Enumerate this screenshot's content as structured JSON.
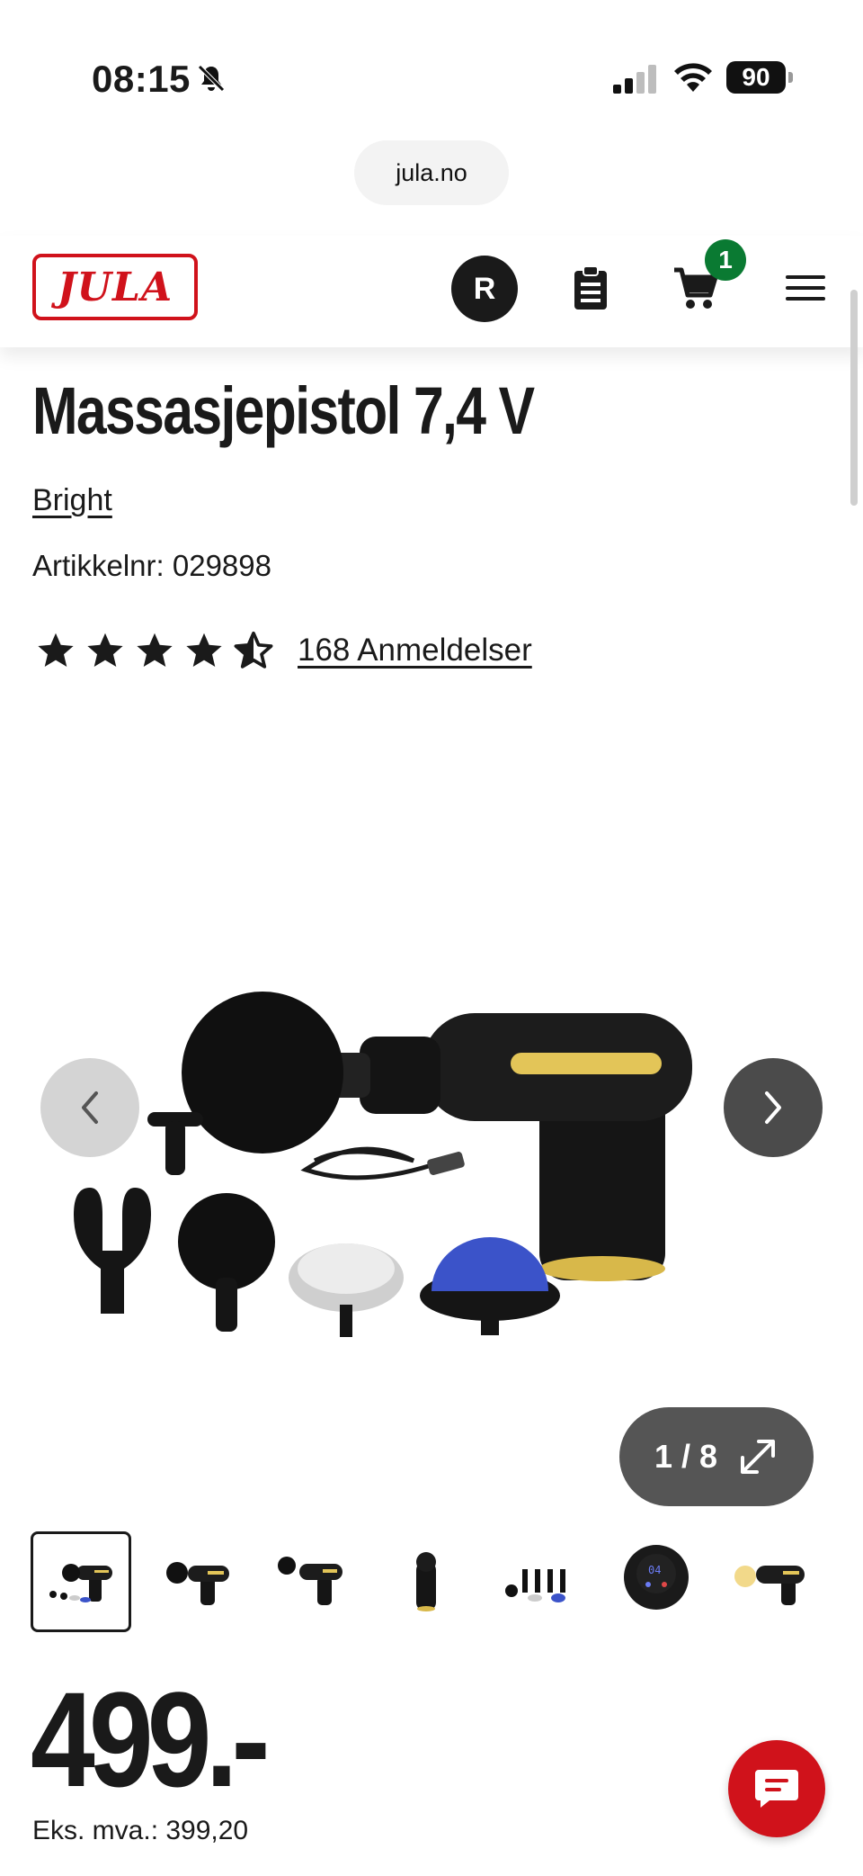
{
  "status_bar": {
    "time": "08:15",
    "battery": "90"
  },
  "browser": {
    "url": "jula.no"
  },
  "header": {
    "logo_text": "JULA",
    "avatar_initial": "R",
    "cart_count": "1"
  },
  "product": {
    "title": "Massasjepistol 7,4 V",
    "brand": "Bright",
    "article_label": "Artikkelnr: 029898",
    "rating": 4.5,
    "reviews_label": "168 Anmeldelser",
    "price": "499.-",
    "vat_label": "Eks. mva.: 399,20"
  },
  "gallery": {
    "counter": "1 / 8",
    "thumbnail_count": 7,
    "active_thumbnail": 1
  },
  "colors": {
    "brand_red": "#d0121b",
    "badge_green": "#0a7a32",
    "text": "#1a1a1a"
  }
}
